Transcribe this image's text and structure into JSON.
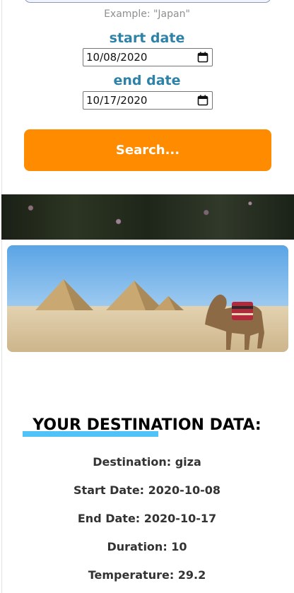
{
  "form": {
    "destination_hint": "Example: \"Japan\"",
    "start_date_label": "start date",
    "start_date_value": "10/08/2020",
    "end_date_label": "end date",
    "end_date_value": "10/17/2020",
    "search_button_label": "Search..."
  },
  "results": {
    "title": "YOUR DESTINATION DATA:",
    "destination": "Destination: giza",
    "start_date": "Start Date: 2020-10-08",
    "end_date": "End Date: 2020-10-17",
    "duration": "Duration: 10",
    "temperature": "Temperature: 29.2"
  },
  "colors": {
    "label_blue": "#2e82a8",
    "button_orange": "#ff8c00",
    "underline_blue": "#4fc3f7"
  },
  "icons": {
    "date_picker": "calendar-icon"
  }
}
